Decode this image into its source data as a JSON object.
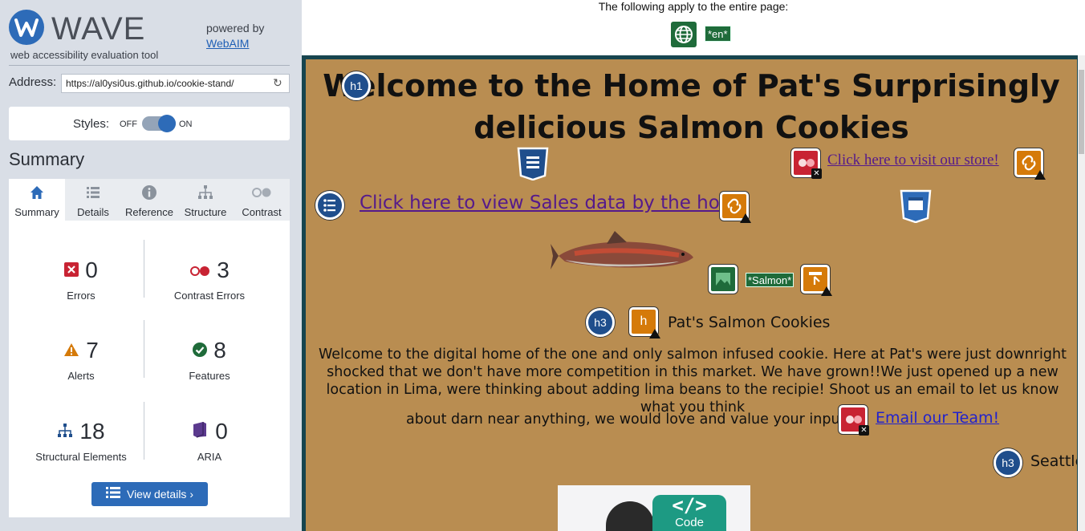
{
  "app": {
    "logo_text": "WAVE",
    "logo_sub": "web accessibility evaluation tool",
    "powered_by": "powered by",
    "powered_link": "WebAIM"
  },
  "address": {
    "label": "Address:",
    "value": "https://al0ysi0us.github.io/cookie-stand/"
  },
  "styles": {
    "label": "Styles:",
    "off": "OFF",
    "on": "ON",
    "enabled": true
  },
  "summary_title": "Summary",
  "tabs": [
    {
      "label": "Summary",
      "icon": "home-icon",
      "active": true
    },
    {
      "label": "Details",
      "icon": "list-icon",
      "active": false
    },
    {
      "label": "Reference",
      "icon": "info-icon",
      "active": false
    },
    {
      "label": "Structure",
      "icon": "hierarchy-icon",
      "active": false
    },
    {
      "label": "Contrast",
      "icon": "contrast-icon",
      "active": false
    }
  ],
  "stats": {
    "errors": {
      "value": "0",
      "label": "Errors"
    },
    "contrast_errors": {
      "value": "3",
      "label": "Contrast Errors"
    },
    "alerts": {
      "value": "7",
      "label": "Alerts"
    },
    "features": {
      "value": "8",
      "label": "Features"
    },
    "structural": {
      "value": "18",
      "label": "Structural Elements"
    },
    "aria": {
      "value": "0",
      "label": "ARIA"
    }
  },
  "view_details": "View details ›",
  "page_header": {
    "text": "The following apply to the entire page:",
    "lang_badge": "*en*"
  },
  "site": {
    "h1": "Welcome to the Home of Pat's Surprisingly delicious Salmon Cookies",
    "store_link": "Click here to visit our store!",
    "sales_link": "Click here to view Sales data by the hour",
    "img_alt_badge": "*Salmon*",
    "h3": "Pat's Salmon Cookies",
    "paragraph": "Welcome to the digital home of the one and only salmon infused cookie. Here at Pat's were just downright shocked that we don't have more competition in this market. We have grown!!We just opened up a new location in Lima, were thinking about adding lima beans to the recipie! Shoot us an email to let us know what you think",
    "paragraph_last": "about darn near anything, we would love and value your input!",
    "email_link": "Email our Team!",
    "seattle": "Seattle",
    "icon_h1": "h1",
    "icon_h3": "h3",
    "icon_h3b": "h3",
    "code_label": "Code",
    "code_symbol": "</>"
  },
  "colors": {
    "wave_blue": "#2d6bb8",
    "site_bg": "#b98d51",
    "error_red": "#c82333",
    "alert_orange": "#d57a09",
    "feature_green": "#1f6b3a",
    "structure_navy": "#1f4e8c"
  }
}
